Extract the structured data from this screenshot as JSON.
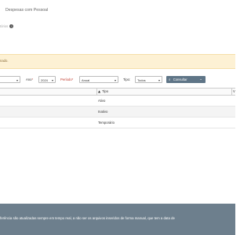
{
  "header": {
    "title": "Despesas com Pessoal",
    "subtitle": "tórios"
  },
  "alert": {
    "text": "nado."
  },
  "filters": {
    "first_select_value": "",
    "ano_label": "Ano",
    "ano_required": "*",
    "ano_value": "2024",
    "periodo_label": "Período",
    "periodo_required": "*",
    "periodo_value": "Anual",
    "tipo_label": "Tipo:",
    "tipo_value": "Todos",
    "consultar_label": "Consultar"
  },
  "table": {
    "columns": [
      "Tipo",
      "V"
    ],
    "rows": [
      {
        "tipo": "Ativo"
      },
      {
        "tipo": "Inativo"
      },
      {
        "tipo": "Temporário"
      }
    ]
  },
  "footer": {
    "text": "ferência são atualizadas sempre em tempo real, a não ser os arquivos inseridos de forma manual, que tem a data de"
  }
}
